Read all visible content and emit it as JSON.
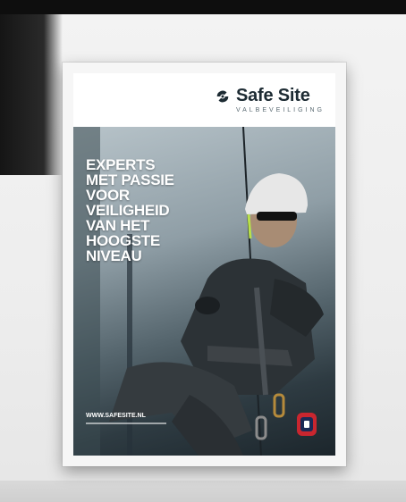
{
  "poster": {
    "brand": {
      "name": "Safe Site",
      "tagline": "VALBEVEILIGING",
      "icon": "safe-site-logo-icon"
    },
    "headline_lines": [
      "EXPERTS",
      "MET PASSIE",
      "VOOR",
      "VEILIGHEID",
      "VAN HET",
      "HOOGSTE",
      "NIVEAU"
    ],
    "website": "WWW.SAFESITE.NL",
    "badge_icon": "certification-badge-icon"
  },
  "colors": {
    "brand_dark": "#1d2b33",
    "headline": "#ffffff",
    "badge_red": "#c9262f",
    "badge_blue": "#1b2a56"
  }
}
